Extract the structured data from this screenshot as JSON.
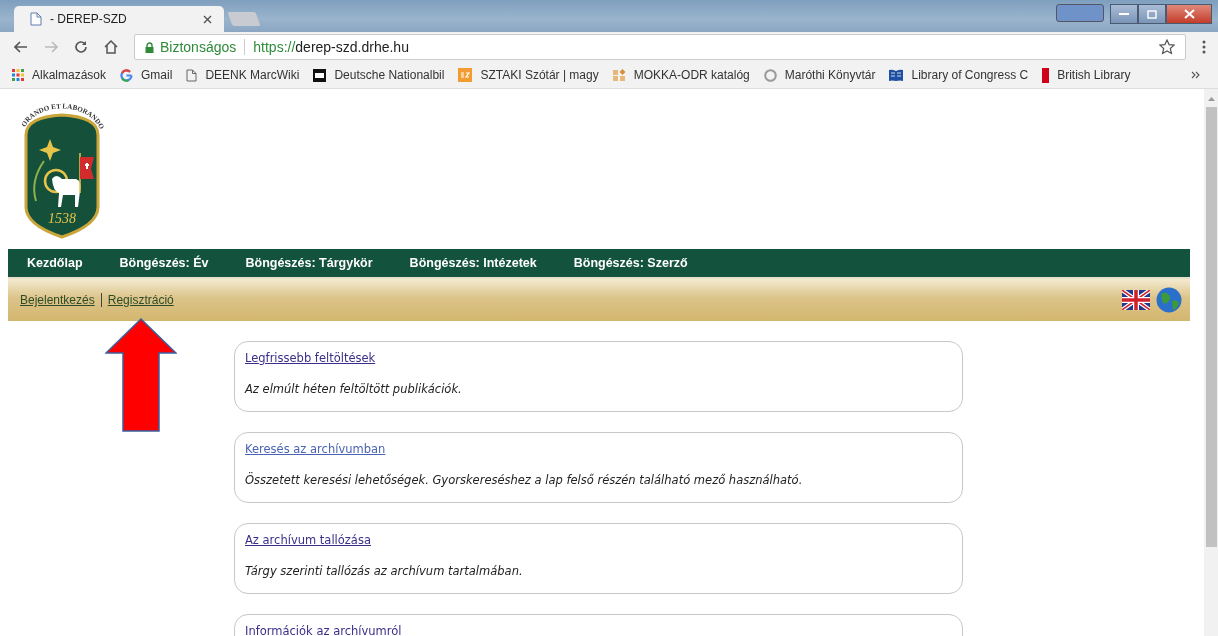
{
  "browser": {
    "tab_title": "- DEREP-SZD",
    "secure_label": "Biztonságos",
    "url_scheme": "https://",
    "url_host": "derep-szd.drhe.hu",
    "bookmarks": [
      {
        "label": "Alkalmazások",
        "kind": "apps"
      },
      {
        "label": "Gmail",
        "kind": "google"
      },
      {
        "label": "DEENK MarcWiki",
        "kind": "page"
      },
      {
        "label": "Deutsche Nationalbil",
        "kind": "dnb"
      },
      {
        "label": "SZTAKI Szótár | magy",
        "kind": "sztaki"
      },
      {
        "label": "MOKKA-ODR katalóg",
        "kind": "mokka"
      },
      {
        "label": "Maróthi Könyvtár",
        "kind": "circle"
      },
      {
        "label": "Library of Congress C",
        "kind": "loc"
      },
      {
        "label": "British Library",
        "kind": "bl"
      }
    ]
  },
  "logo": {
    "motto": "ORANDO ET LABORANDO",
    "year": "1538"
  },
  "nav": [
    {
      "label": "Kezdőlap"
    },
    {
      "label": "Böngészés: Év"
    },
    {
      "label": "Böngészés: Tárgykör"
    },
    {
      "label": "Böngészés: Intézetek"
    },
    {
      "label": "Böngészés: Szerző"
    }
  ],
  "user_links": [
    {
      "label": "Bejelentkezés"
    },
    {
      "label": "Regisztráció"
    }
  ],
  "cards": [
    {
      "title": "Legfrissebb feltöltések",
      "visited": true,
      "description": "Az elmúlt héten feltöltött publikációk."
    },
    {
      "title": "Keresés az archívumban",
      "visited": false,
      "description": "Összetett keresési lehetőségek. Gyorskereséshez a lap felső részén található mező használható."
    },
    {
      "title": "Az archívum tallózása",
      "visited": true,
      "description": "Tárgy szerinti tallózás az archívum tartalmában."
    },
    {
      "title": "Információk az archívumról",
      "visited": true
    }
  ]
}
